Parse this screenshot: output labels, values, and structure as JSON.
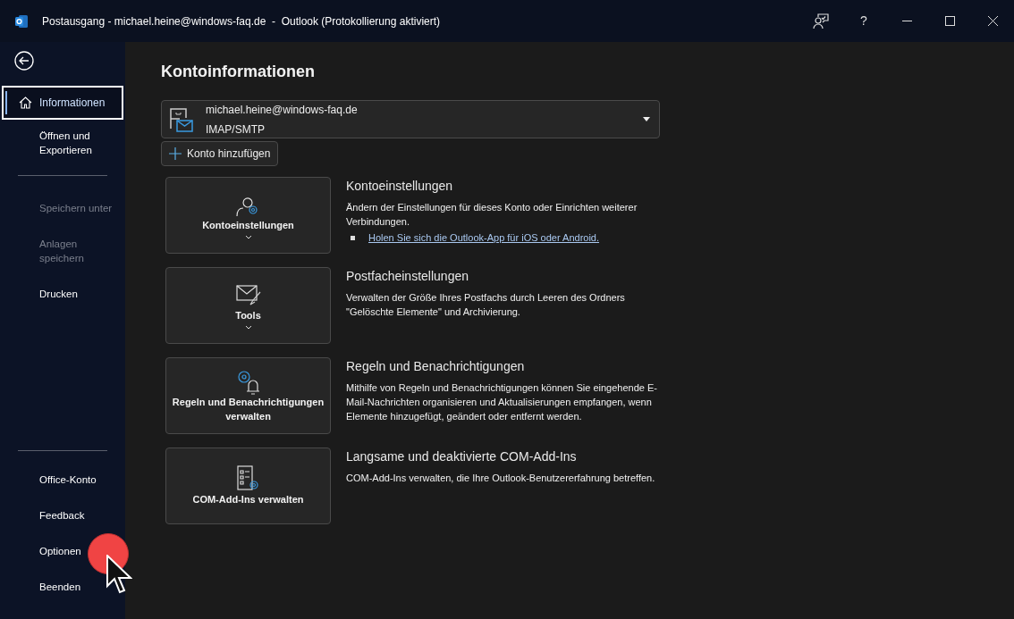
{
  "window": {
    "title": "Postausgang - michael.heine@windows-faq.de  -  Outlook (Protokollierung aktiviert)",
    "help": "?"
  },
  "sidebar": {
    "groups": [
      {
        "items": [
          {
            "label": "Informationen",
            "selected": true,
            "disabled": false
          },
          {
            "label": "Öffnen und Exportieren",
            "selected": false,
            "disabled": false
          }
        ]
      },
      {
        "items": [
          {
            "label": "Speichern unter",
            "selected": false,
            "disabled": true
          },
          {
            "label": "Anlagen speichern",
            "selected": false,
            "disabled": true
          },
          {
            "label": "Drucken",
            "selected": false,
            "disabled": false
          }
        ]
      }
    ],
    "bottom_items": [
      {
        "label": "Office-Konto",
        "selected": false,
        "disabled": false
      },
      {
        "label": "Feedback",
        "selected": false,
        "disabled": false
      },
      {
        "label": "Optionen",
        "selected": false,
        "disabled": false
      },
      {
        "label": "Beenden",
        "selected": false,
        "disabled": false
      }
    ]
  },
  "main": {
    "heading": "Kontoinformationen",
    "account": {
      "email": "michael.heine@windows-faq.de",
      "type": "IMAP/SMTP"
    },
    "add_account": "Konto hinzufügen",
    "sections": [
      {
        "kind": "account",
        "button": "Kontoeinstellungen",
        "dropdown": true,
        "title": "Kontoeinstellungen",
        "description": "Ändern der Einstellungen für dieses Konto oder Einrichten weiterer Verbindungen.",
        "link": "Holen Sie sich die Outlook-App für iOS oder Android."
      },
      {
        "kind": "tools",
        "button": "Tools",
        "dropdown": true,
        "title": "Postfacheinstellungen",
        "description": "Verwalten der Größe Ihres Postfachs durch Leeren des Ordners \"Gelöschte Elemente\" und Archivierung."
      },
      {
        "kind": "rules",
        "button": "Regeln und Benachrichtigungen verwalten",
        "dropdown": false,
        "title": "Regeln und Benachrichtigungen",
        "description": "Mithilfe von Regeln und Benachrichtigungen können Sie eingehende E-Mail-Nachrichten organisieren und Aktualisierungen empfangen, wenn Elemente hinzugefügt, geändert oder entfernt werden."
      },
      {
        "kind": "addins",
        "button": "COM-Add-Ins verwalten",
        "dropdown": false,
        "title": "Langsame und deaktivierte COM-Add-Ins",
        "description": "COM-Add-Ins verwalten, die Ihre Outlook-Benutzererfahrung betreffen."
      }
    ]
  }
}
